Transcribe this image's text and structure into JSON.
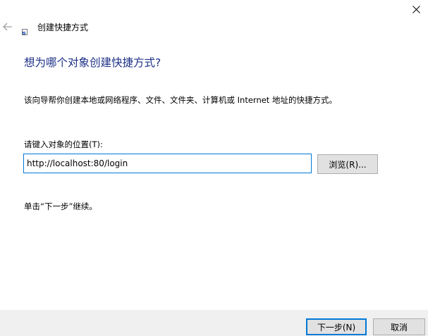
{
  "window": {
    "close_glyph": "✕"
  },
  "header": {
    "back_icon": "arrow-left-icon",
    "wizard_icon": "shortcut-icon",
    "title": "创建快捷方式"
  },
  "main": {
    "heading": "想为哪个对象创建快捷方式?",
    "description": "该向导帮你创建本地或网络程序、文件、文件夹、计算机或 Internet 地址的快捷方式。",
    "location_label": "请键入对象的位置(T):",
    "location_value": "http://localhost:80/login",
    "browse_button": "浏览(R)...",
    "hint": "单击“下一步”继续。"
  },
  "footer": {
    "next_button": "下一步(N)",
    "cancel_button": "取消"
  },
  "colors": {
    "heading": "#1e3287",
    "accent": "#0078d7",
    "button_face": "#e1e1e1",
    "footer_bg": "#f0f0f0"
  }
}
